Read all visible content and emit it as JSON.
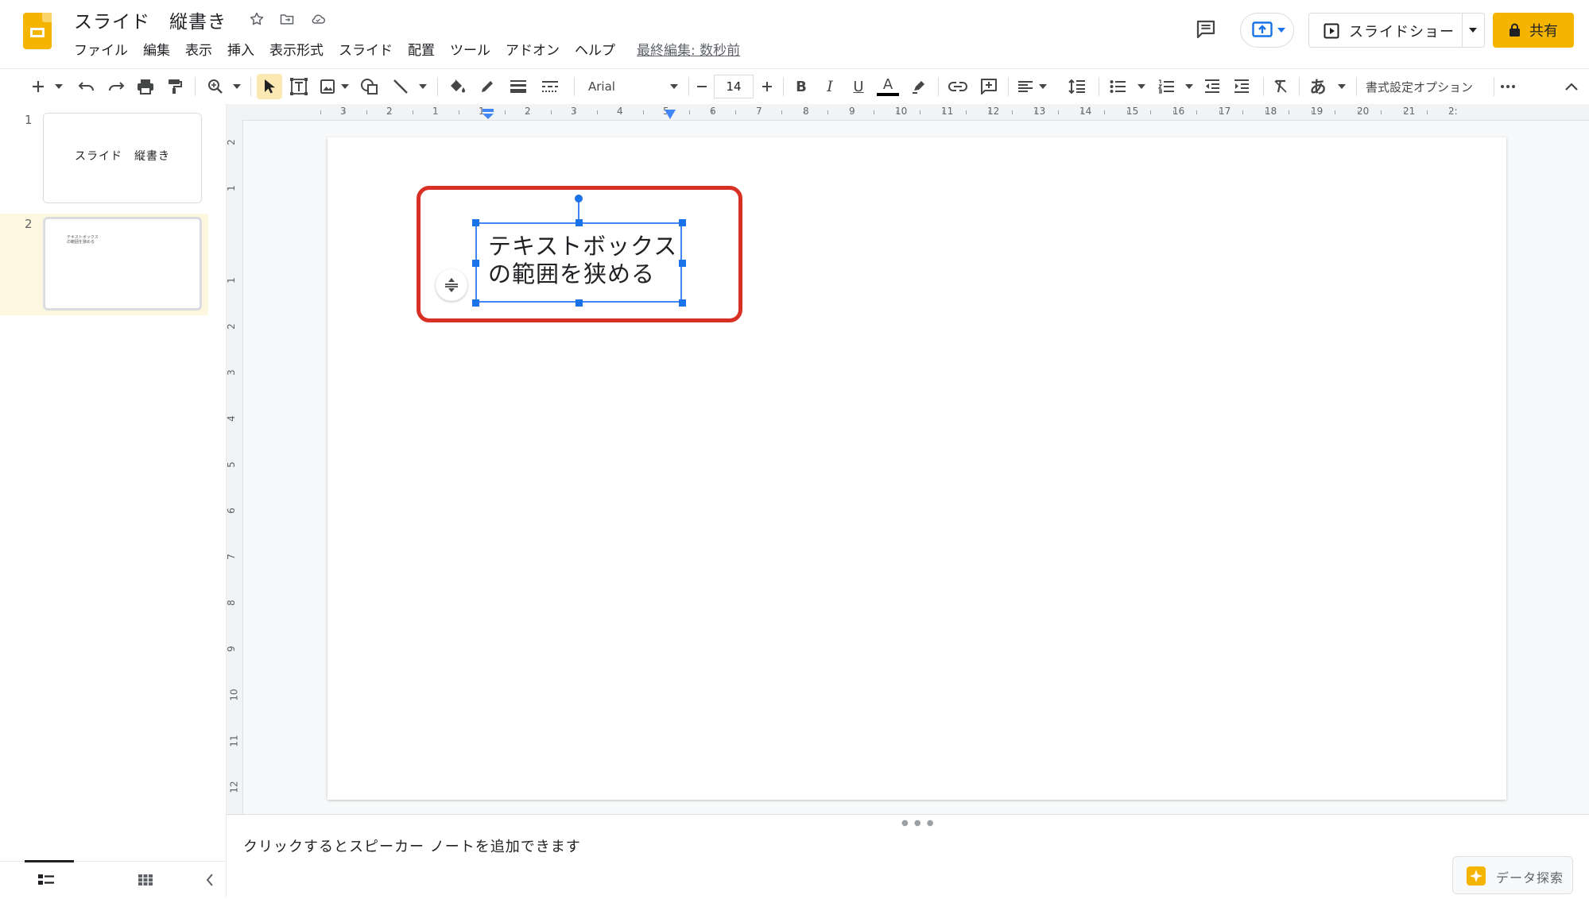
{
  "app": {
    "title": "スライド　縦書き",
    "menu": [
      "ファイル",
      "編集",
      "表示",
      "挿入",
      "表示形式",
      "スライド",
      "配置",
      "ツール",
      "アドオン",
      "ヘルプ"
    ],
    "last_edit": "最終編集: 数秒前",
    "slideshow_label": "スライドショー",
    "share_label": "共有",
    "brand_color": "#f4b400",
    "accent_color": "#1a73e8",
    "highlight_color": "#d93025"
  },
  "toolbar": {
    "font": "Arial",
    "font_size": "14",
    "bold": "B",
    "italic": "I",
    "underline": "U",
    "text_color": "A",
    "input_tools": "あ",
    "format_options": "書式設定オプション"
  },
  "rulers": {
    "horizontal": [
      "3",
      "2",
      "1",
      "1",
      "2",
      "3",
      "4",
      "5",
      "6",
      "7",
      "8",
      "9",
      "10",
      "11",
      "12",
      "13",
      "14",
      "15",
      "16",
      "17",
      "18",
      "19",
      "20",
      "21",
      "2:"
    ],
    "vertical": [
      "2",
      "1",
      "1",
      "2",
      "3",
      "4",
      "5",
      "6",
      "7",
      "8",
      "9",
      "10",
      "11",
      "12"
    ]
  },
  "filmstrip": {
    "slides": [
      {
        "number": "1",
        "title": "スライド　縦書き"
      },
      {
        "number": "2",
        "line1": "テキストボックス",
        "line2": "の範囲を狭める"
      }
    ]
  },
  "slide": {
    "textbox_line1": "テキストボックス",
    "textbox_line2": "の範囲を狭める"
  },
  "notes": {
    "placeholder": "クリックするとスピーカー ノートを追加できます",
    "explore_label": "データ探索"
  }
}
